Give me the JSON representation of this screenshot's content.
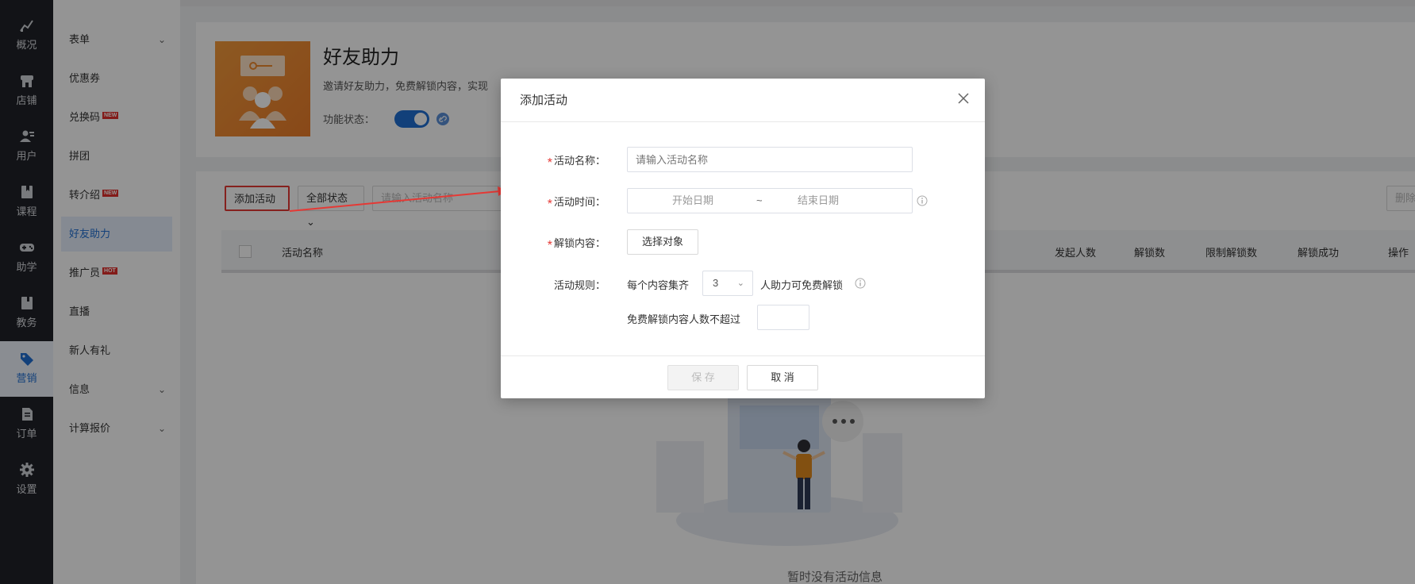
{
  "rail": {
    "items": [
      {
        "label": "概况",
        "icon": "chart-icon"
      },
      {
        "label": "店铺",
        "icon": "store-icon"
      },
      {
        "label": "用户",
        "icon": "users-icon"
      },
      {
        "label": "课程",
        "icon": "book-icon"
      },
      {
        "label": "助学",
        "icon": "gamepad-icon"
      },
      {
        "label": "教务",
        "icon": "clipboard-icon"
      },
      {
        "label": "营销",
        "icon": "tag-icon",
        "active": true
      },
      {
        "label": "订单",
        "icon": "order-icon"
      },
      {
        "label": "设置",
        "icon": "gear-icon"
      }
    ]
  },
  "submenu": {
    "items": [
      {
        "label": "表单",
        "chevron": true
      },
      {
        "label": "优惠券"
      },
      {
        "label": "兑换码",
        "badge": "NEW"
      },
      {
        "label": "拼团"
      },
      {
        "label": "转介绍",
        "badge": "NEW"
      },
      {
        "label": "好友助力",
        "active": true
      },
      {
        "label": "推广员",
        "badge": "HOT"
      },
      {
        "label": "直播"
      },
      {
        "label": "新人有礼"
      },
      {
        "label": "信息",
        "chevron": true
      },
      {
        "label": "计算报价",
        "chevron": true
      }
    ]
  },
  "header": {
    "title": "好友助力",
    "description": "邀请好友助力，免费解锁内容，实现",
    "status_label": "功能状态：",
    "status_on": true
  },
  "toolbar": {
    "add_label": "添加活动",
    "status_filter": "全部状态",
    "search_placeholder": "请输入活动名称",
    "delete_label": "删除选中"
  },
  "table": {
    "columns": [
      "活动名称",
      "发起人数",
      "解锁数",
      "限制解锁数",
      "解锁成功",
      "操作"
    ],
    "empty_text": "暂时没有活动信息"
  },
  "modal": {
    "title": "添加活动",
    "name_label": "活动名称：",
    "name_placeholder": "请输入活动名称",
    "time_label": "活动时间：",
    "start_placeholder": "开始日期",
    "range_sep": "~",
    "end_placeholder": "结束日期",
    "unlock_label": "解锁内容：",
    "choose_button": "选择对象",
    "rule_label": "活动规则：",
    "rule_prefix": "每个内容集齐",
    "rule_count": "3",
    "rule_suffix": "人助力可免费解锁",
    "limit_text": "免费解锁内容人数不超过",
    "limit_value": "",
    "save_label": "保 存",
    "cancel_label": "取 消"
  },
  "colors": {
    "primary": "#1f6fd3",
    "danger": "#e53935",
    "rail_bg": "#1f2228"
  }
}
